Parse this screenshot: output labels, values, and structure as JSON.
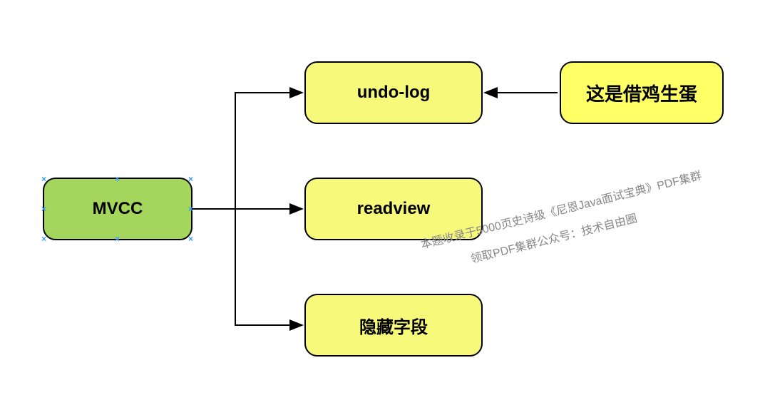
{
  "nodes": {
    "root": {
      "label": "MVCC"
    },
    "child1": {
      "label": "undo-log"
    },
    "child2": {
      "label": "readview"
    },
    "child3": {
      "label": "隐藏字段"
    },
    "annotation": {
      "label": "这是借鸡生蛋"
    }
  },
  "watermark": {
    "line1": "本题收录于5000页史诗级《尼恩Java面试宝典》PDF集群",
    "line2": "领取PDF集群公众号：技术自由圈"
  },
  "colors": {
    "green": "#a4d65e",
    "yellow": "#f7f97a",
    "yellowBright": "#ffff66",
    "handleBlue": "#3399ff"
  }
}
